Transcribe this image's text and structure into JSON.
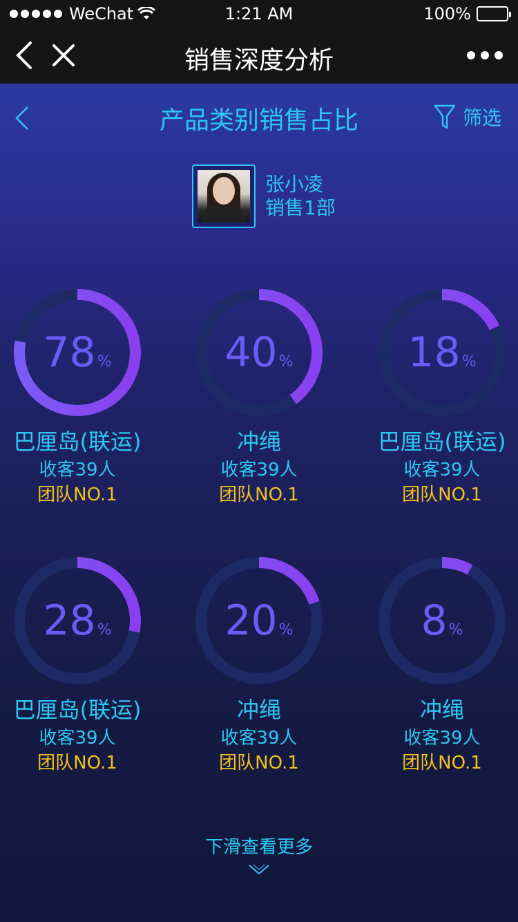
{
  "status_bar": {
    "carrier": "WeChat",
    "time": "1:21 AM",
    "battery": "100%"
  },
  "nav": {
    "title": "销售深度分析"
  },
  "subheader": {
    "title": "产品类别销售占比",
    "filter_label": "筛选"
  },
  "profile": {
    "name": "张小凌",
    "department": "销售1部"
  },
  "colors": {
    "accent": "#2ec6f2",
    "ring": "#6a5cf6",
    "ring_track": "#1d2a66",
    "highlight": "#f2c21b"
  },
  "cards": [
    {
      "percent": "78",
      "unit": "%",
      "value": 78,
      "name": "巴厘岛(联运)",
      "customers": "收客39人",
      "team": "团队NO.1"
    },
    {
      "percent": "40",
      "unit": "%",
      "value": 40,
      "name": "冲绳",
      "customers": "收客39人",
      "team": "团队NO.1"
    },
    {
      "percent": "18",
      "unit": "%",
      "value": 18,
      "name": "巴厘岛(联运)",
      "customers": "收客39人",
      "team": "团队NO.1"
    },
    {
      "percent": "28",
      "unit": "%",
      "value": 28,
      "name": "巴厘岛(联运)",
      "customers": "收客39人",
      "team": "团队NO.1"
    },
    {
      "percent": "20",
      "unit": "%",
      "value": 20,
      "name": "冲绳",
      "customers": "收客39人",
      "team": "团队NO.1"
    },
    {
      "percent": "8",
      "unit": "%",
      "value": 8,
      "name": "冲绳",
      "customers": "收客39人",
      "team": "团队NO.1"
    }
  ],
  "footer": {
    "hint": "下滑查看更多"
  },
  "icons": [
    "signal-dots-icon",
    "wifi-icon",
    "battery-icon",
    "back-arrow-icon",
    "close-icon",
    "more-icon",
    "filter-icon",
    "chevron-down-icon"
  ]
}
